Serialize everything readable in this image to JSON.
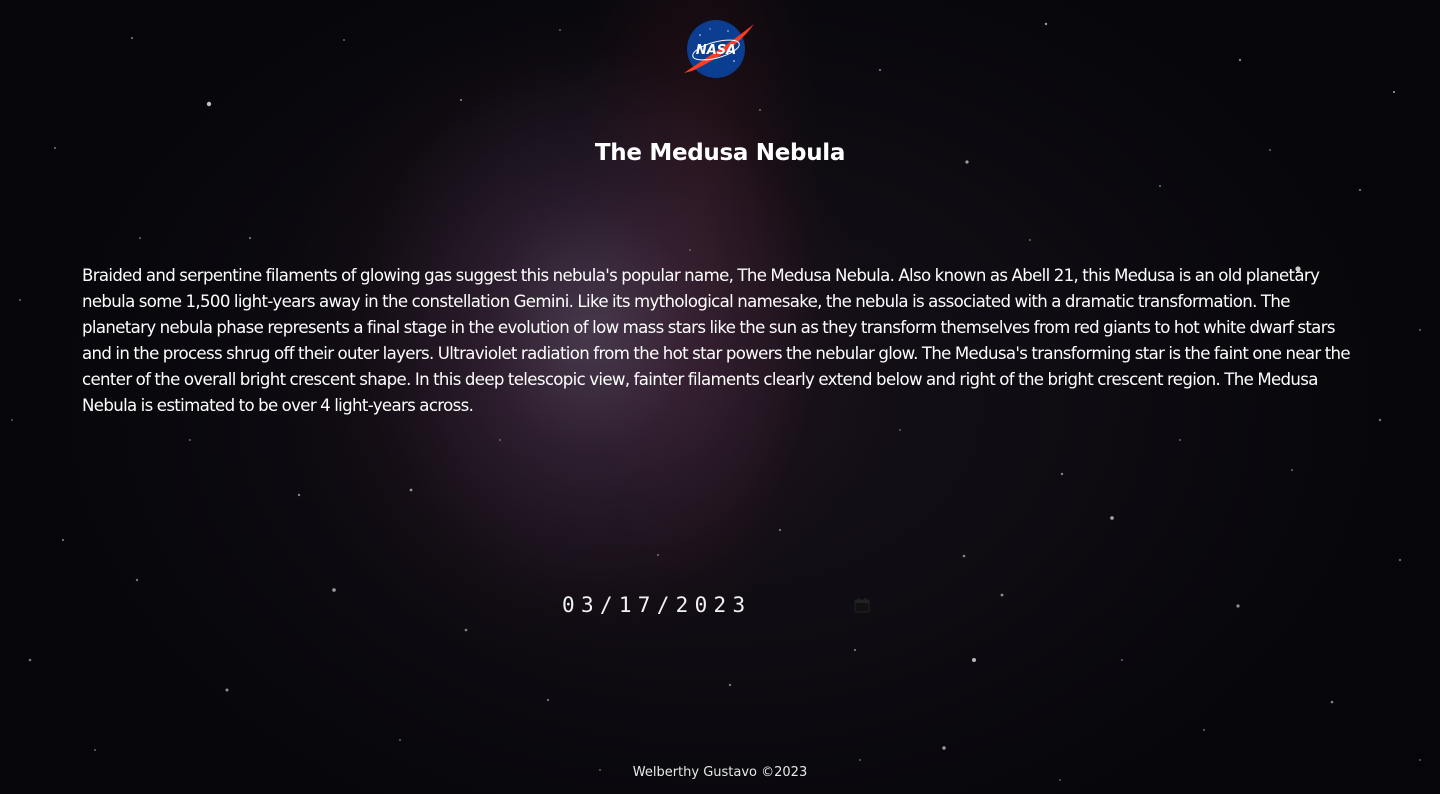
{
  "header": {
    "logo_text": "NASA",
    "logo_colors": {
      "circle": "#0b3d91",
      "chevron": "#fc3d21",
      "text": "#ffffff"
    }
  },
  "apod": {
    "title": "The Medusa Nebula",
    "explanation": "Braided and serpentine filaments of glowing gas suggest this nebula's popular name, The Medusa Nebula. Also known as Abell 21, this Medusa is an old planetary nebula some 1,500 light-years away in the constellation Gemini. Like its mythological namesake, the nebula is associated with a dramatic transformation. The planetary nebula phase represents a final stage in the evolution of low mass stars like the sun as they transform themselves from red giants to hot white dwarf stars and in the process shrug off their outer layers. Ultraviolet radiation from the hot star powers the nebular glow. The Medusa's transforming star is the faint one near the center of the overall bright crescent shape. In this deep telescopic view, fainter filaments clearly extend below and right of the bright crescent region. The Medusa Nebula is estimated to be over 4 light-years across."
  },
  "date_picker": {
    "value": "03/17/2023",
    "icon": "calendar-icon"
  },
  "footer": {
    "text": "Welberthy Gustavo ©2023"
  }
}
